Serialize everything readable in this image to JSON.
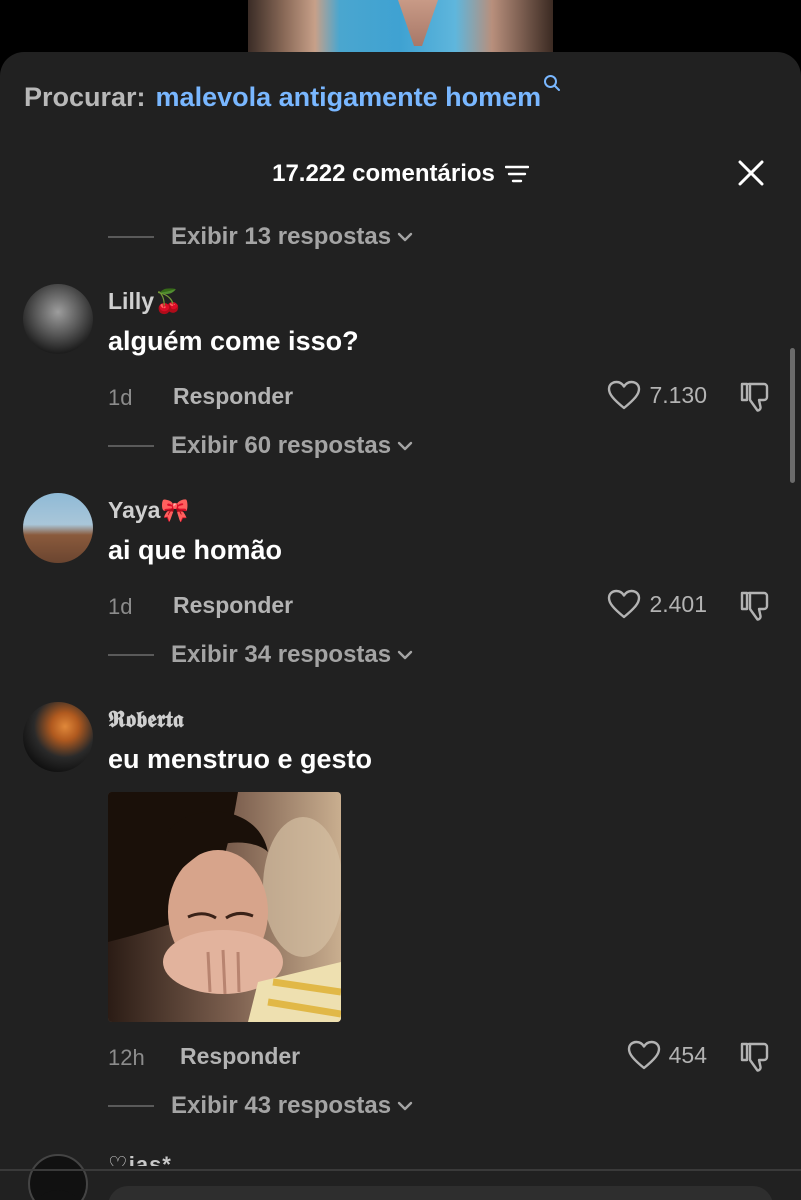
{
  "search": {
    "prefix": "Procurar:",
    "query": "malevola antigamente homem",
    "icon": "search-icon"
  },
  "header": {
    "count_label": "17.222 comentários",
    "filter_icon": "filter-icon",
    "close_icon": "close-icon"
  },
  "replies_top": {
    "label": "Exibir 13 respostas"
  },
  "comments": [
    {
      "username": "Lilly",
      "emoji": "🍒",
      "text": "alguém come isso?",
      "time": "1d",
      "reply_label": "Responder",
      "likes": "7.130",
      "replies_label": "Exibir 60 respostas"
    },
    {
      "username": "Yaya",
      "emoji": "🎀",
      "text": "ai que homão",
      "time": "1d",
      "reply_label": "Responder",
      "likes": "2.401",
      "replies_label": "Exibir 34 respostas"
    },
    {
      "username": "𝕽𝖔𝖇𝖊𝖗𝖙𝖆",
      "emoji": "",
      "text": "eu menstruo e gesto",
      "time": "12h",
      "reply_label": "Responder",
      "likes": "454",
      "replies_label": "Exibir 43 respostas"
    }
  ],
  "peek": {
    "username": "♡ias*"
  },
  "colors": {
    "sheet_bg": "#212121",
    "accent_link": "#79b7ff",
    "muted": "#a4a4a4"
  }
}
